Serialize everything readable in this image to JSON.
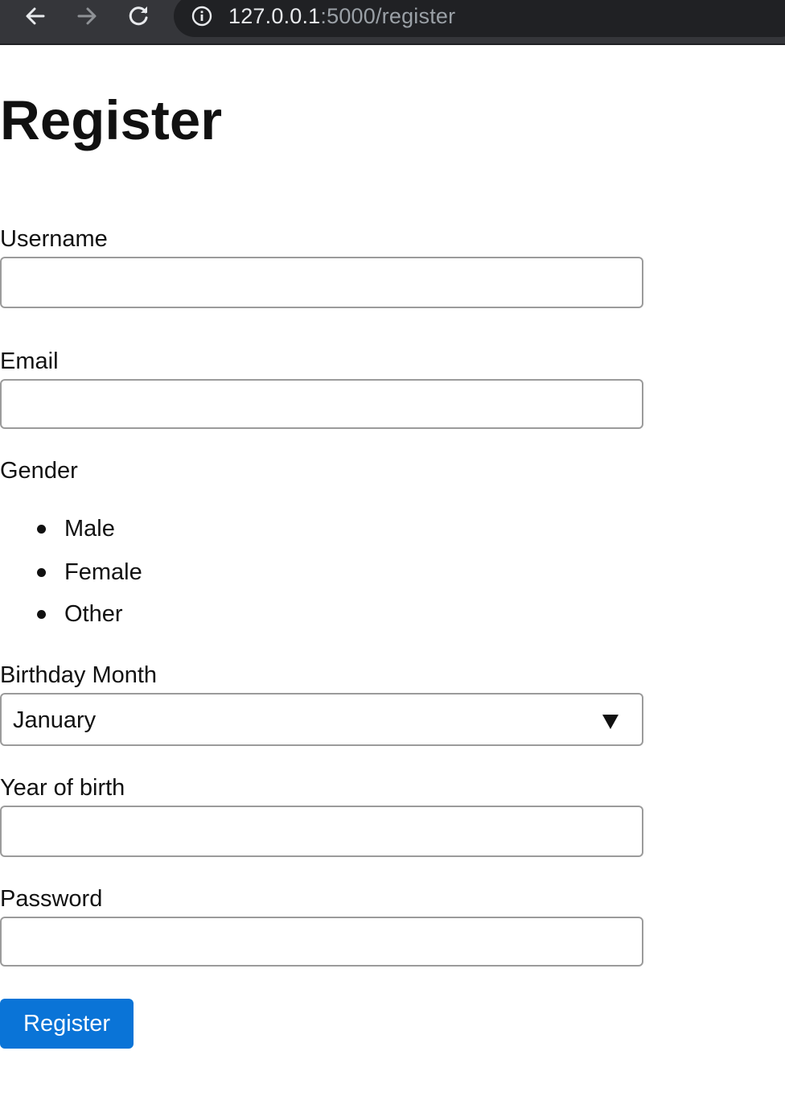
{
  "browser": {
    "url_host": "127.0.0.1",
    "url_path": ":5000/register",
    "icons": {
      "back": "back-arrow-icon",
      "forward": "forward-arrow-icon",
      "reload": "reload-icon",
      "info": "info-icon"
    }
  },
  "page": {
    "title": "Register"
  },
  "form": {
    "username": {
      "label": "Username",
      "value": ""
    },
    "email": {
      "label": "Email",
      "value": ""
    },
    "gender": {
      "label": "Gender",
      "options": [
        "Male",
        "Female",
        "Other"
      ]
    },
    "birthday_month": {
      "label": "Birthday Month",
      "selected": "January"
    },
    "year_of_birth": {
      "label": "Year of birth",
      "value": ""
    },
    "password": {
      "label": "Password",
      "value": ""
    },
    "submit_label": "Register"
  },
  "colors": {
    "toolbar_bg": "#35363a",
    "omnibox_bg": "#202124",
    "button_bg": "#0a74d7",
    "input_border": "#9b9b9b"
  }
}
